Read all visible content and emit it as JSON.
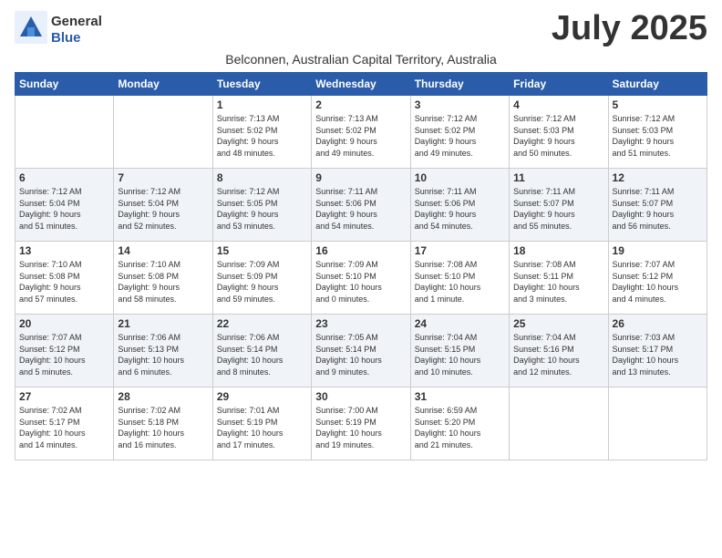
{
  "logo": {
    "general": "General",
    "blue": "Blue"
  },
  "title": "July 2025",
  "subtitle": "Belconnen, Australian Capital Territory, Australia",
  "headers": [
    "Sunday",
    "Monday",
    "Tuesday",
    "Wednesday",
    "Thursday",
    "Friday",
    "Saturday"
  ],
  "weeks": [
    [
      {
        "day": "",
        "content": ""
      },
      {
        "day": "",
        "content": ""
      },
      {
        "day": "1",
        "content": "Sunrise: 7:13 AM\nSunset: 5:02 PM\nDaylight: 9 hours\nand 48 minutes."
      },
      {
        "day": "2",
        "content": "Sunrise: 7:13 AM\nSunset: 5:02 PM\nDaylight: 9 hours\nand 49 minutes."
      },
      {
        "day": "3",
        "content": "Sunrise: 7:12 AM\nSunset: 5:02 PM\nDaylight: 9 hours\nand 49 minutes."
      },
      {
        "day": "4",
        "content": "Sunrise: 7:12 AM\nSunset: 5:03 PM\nDaylight: 9 hours\nand 50 minutes."
      },
      {
        "day": "5",
        "content": "Sunrise: 7:12 AM\nSunset: 5:03 PM\nDaylight: 9 hours\nand 51 minutes."
      }
    ],
    [
      {
        "day": "6",
        "content": "Sunrise: 7:12 AM\nSunset: 5:04 PM\nDaylight: 9 hours\nand 51 minutes."
      },
      {
        "day": "7",
        "content": "Sunrise: 7:12 AM\nSunset: 5:04 PM\nDaylight: 9 hours\nand 52 minutes."
      },
      {
        "day": "8",
        "content": "Sunrise: 7:12 AM\nSunset: 5:05 PM\nDaylight: 9 hours\nand 53 minutes."
      },
      {
        "day": "9",
        "content": "Sunrise: 7:11 AM\nSunset: 5:06 PM\nDaylight: 9 hours\nand 54 minutes."
      },
      {
        "day": "10",
        "content": "Sunrise: 7:11 AM\nSunset: 5:06 PM\nDaylight: 9 hours\nand 54 minutes."
      },
      {
        "day": "11",
        "content": "Sunrise: 7:11 AM\nSunset: 5:07 PM\nDaylight: 9 hours\nand 55 minutes."
      },
      {
        "day": "12",
        "content": "Sunrise: 7:11 AM\nSunset: 5:07 PM\nDaylight: 9 hours\nand 56 minutes."
      }
    ],
    [
      {
        "day": "13",
        "content": "Sunrise: 7:10 AM\nSunset: 5:08 PM\nDaylight: 9 hours\nand 57 minutes."
      },
      {
        "day": "14",
        "content": "Sunrise: 7:10 AM\nSunset: 5:08 PM\nDaylight: 9 hours\nand 58 minutes."
      },
      {
        "day": "15",
        "content": "Sunrise: 7:09 AM\nSunset: 5:09 PM\nDaylight: 9 hours\nand 59 minutes."
      },
      {
        "day": "16",
        "content": "Sunrise: 7:09 AM\nSunset: 5:10 PM\nDaylight: 10 hours\nand 0 minutes."
      },
      {
        "day": "17",
        "content": "Sunrise: 7:08 AM\nSunset: 5:10 PM\nDaylight: 10 hours\nand 1 minute."
      },
      {
        "day": "18",
        "content": "Sunrise: 7:08 AM\nSunset: 5:11 PM\nDaylight: 10 hours\nand 3 minutes."
      },
      {
        "day": "19",
        "content": "Sunrise: 7:07 AM\nSunset: 5:12 PM\nDaylight: 10 hours\nand 4 minutes."
      }
    ],
    [
      {
        "day": "20",
        "content": "Sunrise: 7:07 AM\nSunset: 5:12 PM\nDaylight: 10 hours\nand 5 minutes."
      },
      {
        "day": "21",
        "content": "Sunrise: 7:06 AM\nSunset: 5:13 PM\nDaylight: 10 hours\nand 6 minutes."
      },
      {
        "day": "22",
        "content": "Sunrise: 7:06 AM\nSunset: 5:14 PM\nDaylight: 10 hours\nand 8 minutes."
      },
      {
        "day": "23",
        "content": "Sunrise: 7:05 AM\nSunset: 5:14 PM\nDaylight: 10 hours\nand 9 minutes."
      },
      {
        "day": "24",
        "content": "Sunrise: 7:04 AM\nSunset: 5:15 PM\nDaylight: 10 hours\nand 10 minutes."
      },
      {
        "day": "25",
        "content": "Sunrise: 7:04 AM\nSunset: 5:16 PM\nDaylight: 10 hours\nand 12 minutes."
      },
      {
        "day": "26",
        "content": "Sunrise: 7:03 AM\nSunset: 5:17 PM\nDaylight: 10 hours\nand 13 minutes."
      }
    ],
    [
      {
        "day": "27",
        "content": "Sunrise: 7:02 AM\nSunset: 5:17 PM\nDaylight: 10 hours\nand 14 minutes."
      },
      {
        "day": "28",
        "content": "Sunrise: 7:02 AM\nSunset: 5:18 PM\nDaylight: 10 hours\nand 16 minutes."
      },
      {
        "day": "29",
        "content": "Sunrise: 7:01 AM\nSunset: 5:19 PM\nDaylight: 10 hours\nand 17 minutes."
      },
      {
        "day": "30",
        "content": "Sunrise: 7:00 AM\nSunset: 5:19 PM\nDaylight: 10 hours\nand 19 minutes."
      },
      {
        "day": "31",
        "content": "Sunrise: 6:59 AM\nSunset: 5:20 PM\nDaylight: 10 hours\nand 21 minutes."
      },
      {
        "day": "",
        "content": ""
      },
      {
        "day": "",
        "content": ""
      }
    ]
  ]
}
